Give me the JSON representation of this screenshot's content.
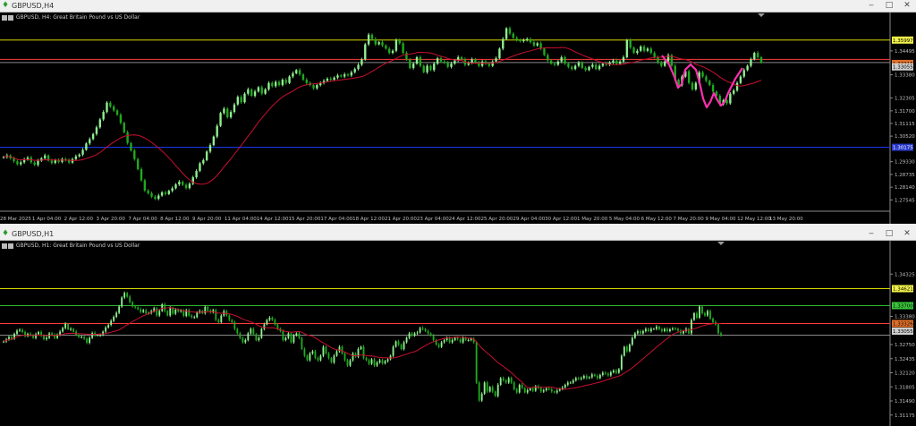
{
  "window_top": {
    "title": "GBPUSD,H4"
  },
  "window_bottom": {
    "title": "GBPUSD,H1"
  },
  "colors": {
    "bull": "#90ee90",
    "bear": "#1faa1f",
    "ma": "#c8102e",
    "yellow_line": "#d7d700",
    "red_line": "#ff3b3b",
    "blue_line": "#1e3cff",
    "green_line": "#2eb82e",
    "grey_line": "#888888",
    "pink_drawing": "#ff2fb0",
    "axis_text": "#bfbfbf",
    "label_yellow": "#f2f24a",
    "label_orange": "#e0702a",
    "label_green": "#3ac43a",
    "label_blue": "#2838c8",
    "label_grey": "#cfcfcf"
  },
  "chart_data": [
    {
      "type": "candlestick",
      "symbol": "GBPUSD",
      "timeframe": "H4",
      "title": "GBPUSD, H4: Great Britain Pound vs US Dollar",
      "ylim": [
        1.2702,
        1.357
      ],
      "yticks": [
        1.34495,
        1.3338,
        1.32305,
        1.317,
        1.31115,
        1.3052,
        1.2933,
        1.28735,
        1.2814,
        1.27545
      ],
      "xticks": [
        "28 Mar 2025",
        "1 Apr 04:00",
        "2 Apr 12:00",
        "3 Apr 20:00",
        "7 Apr 04:00",
        "8 Apr 12:00",
        "9 Apr 20:00",
        "11 Apr 04:00",
        "14 Apr 12:00",
        "15 Apr 20:00",
        "17 Apr 04:00",
        "18 Apr 12:00",
        "21 Apr 20:00",
        "23 Apr 04:00",
        "24 Apr 12:00",
        "25 Apr 20:00",
        "29 Apr 04:00",
        "30 Apr 12:00",
        "1 May 20:00",
        "5 May 04:00",
        "6 May 12:00",
        "7 May 20:00",
        "9 May 04:00",
        "12 May 12:00",
        "13 May 20:00"
      ],
      "price_labels": [
        {
          "value": "1.35997",
          "price": 1.35,
          "style": "yellow"
        },
        {
          "value": "1.33315",
          "price": 1.3391,
          "style": "orange"
        },
        {
          "value": "1.33055",
          "price": 1.3375,
          "style": "grey"
        },
        {
          "value": "1.30175",
          "price": 1.3,
          "style": "blue"
        }
      ],
      "hlines": [
        {
          "price": 1.35,
          "color": "yellow_line"
        },
        {
          "price": 1.341,
          "color": "red_line"
        },
        {
          "price": 1.3395,
          "color": "grey_line"
        },
        {
          "price": 1.3,
          "color": "blue_line"
        }
      ],
      "closes": [
        1.2955,
        1.2962,
        1.2948,
        1.2935,
        1.2921,
        1.293,
        1.2944,
        1.2952,
        1.293,
        1.2918,
        1.2937,
        1.2949,
        1.2962,
        1.2938,
        1.2927,
        1.294,
        1.2932,
        1.2945,
        1.294,
        1.2929,
        1.2945,
        1.2958,
        1.2966,
        1.2988,
        1.3018,
        1.3038,
        1.3062,
        1.3093,
        1.313,
        1.3165,
        1.3208,
        1.319,
        1.3172,
        1.3152,
        1.3114,
        1.307,
        1.302,
        1.2985,
        1.2945,
        1.2898,
        1.2846,
        1.2798,
        1.2786,
        1.277,
        1.276,
        1.2775,
        1.279,
        1.2782,
        1.2797,
        1.2809,
        1.2827,
        1.2839,
        1.2825,
        1.281,
        1.283,
        1.286,
        1.289,
        1.2925,
        1.294,
        1.298,
        1.301,
        1.305,
        1.31,
        1.316,
        1.318,
        1.314,
        1.3165,
        1.32,
        1.3235,
        1.321,
        1.325,
        1.327,
        1.324,
        1.326,
        1.328,
        1.325,
        1.327,
        1.33,
        1.3285,
        1.3305,
        1.329,
        1.3315,
        1.33,
        1.333,
        1.3345,
        1.336,
        1.334,
        1.3315,
        1.33,
        1.329,
        1.3275,
        1.329,
        1.33,
        1.331,
        1.332,
        1.3315,
        1.3325,
        1.3335,
        1.333,
        1.334,
        1.3335,
        1.335,
        1.3365,
        1.3385,
        1.341,
        1.348,
        1.3525,
        1.3505,
        1.348,
        1.349,
        1.3475,
        1.346,
        1.344,
        1.345,
        1.35,
        1.3485,
        1.344,
        1.341,
        1.337,
        1.339,
        1.342,
        1.338,
        1.335,
        1.338,
        1.336,
        1.339,
        1.3415,
        1.34,
        1.3395,
        1.3375,
        1.339,
        1.3405,
        1.342,
        1.341,
        1.3385,
        1.3395,
        1.341,
        1.3395,
        1.338,
        1.34,
        1.339,
        1.338,
        1.34,
        1.3415,
        1.346,
        1.3505,
        1.3555,
        1.353,
        1.351,
        1.35,
        1.3495,
        1.35,
        1.3505,
        1.349,
        1.3475,
        1.3485,
        1.346,
        1.343,
        1.3405,
        1.339,
        1.3385,
        1.34,
        1.342,
        1.339,
        1.3375,
        1.3365,
        1.338,
        1.3395,
        1.337,
        1.336,
        1.3375,
        1.3385,
        1.3365,
        1.338,
        1.339,
        1.3385,
        1.3395,
        1.3405,
        1.339,
        1.34,
        1.342,
        1.35,
        1.3465,
        1.344,
        1.345,
        1.347,
        1.345,
        1.346,
        1.344,
        1.342,
        1.3395,
        1.338,
        1.34,
        1.343,
        1.338,
        1.3315,
        1.329,
        1.333,
        1.3355,
        1.33,
        1.327,
        1.33,
        1.335,
        1.333,
        1.331,
        1.329,
        1.326,
        1.324,
        1.32,
        1.322,
        1.3205,
        1.325,
        1.3265,
        1.33,
        1.333,
        1.336,
        1.338,
        1.341,
        1.344,
        1.342,
        1.3395
      ]
    },
    {
      "type": "candlestick",
      "symbol": "GBPUSD",
      "timeframe": "H1",
      "title": "GBPUSD, H1: Great Britain Pound vs US Dollar",
      "ylim": [
        1.3097,
        1.3479
      ],
      "yticks": [
        1.34325,
        1.3338,
        1.3275,
        1.32435,
        1.3212,
        1.31805,
        1.3149,
        1.31175
      ],
      "price_labels": [
        {
          "value": "1.34621",
          "price": 1.34,
          "style": "yellow"
        },
        {
          "value": "1.33700",
          "price": 1.3362,
          "style": "green"
        },
        {
          "value": "1.33326",
          "price": 1.3322,
          "style": "orange"
        },
        {
          "value": "1.33055",
          "price": 1.3305,
          "style": "grey"
        }
      ],
      "hlines": [
        {
          "price": 1.34,
          "color": "yellow_line"
        },
        {
          "price": 1.3362,
          "color": "green_line"
        },
        {
          "price": 1.3322,
          "color": "red_line"
        },
        {
          "price": 1.3296,
          "color": "grey_line"
        }
      ],
      "closes": [
        1.3282,
        1.3286,
        1.3292,
        1.3288,
        1.3299,
        1.3306,
        1.3308,
        1.3303,
        1.3294,
        1.3299,
        1.3296,
        1.329,
        1.3298,
        1.3303,
        1.3295,
        1.3287,
        1.329,
        1.33,
        1.3297,
        1.329,
        1.3297,
        1.3304,
        1.3312,
        1.3321,
        1.3309,
        1.331,
        1.3304,
        1.3297,
        1.3292,
        1.3292,
        1.3288,
        1.3279,
        1.329,
        1.3301,
        1.3296,
        1.3296,
        1.3296,
        1.3304,
        1.3313,
        1.3319,
        1.3328,
        1.3337,
        1.3346,
        1.336,
        1.338,
        1.339,
        1.3382,
        1.337,
        1.336,
        1.3358,
        1.3354,
        1.3348,
        1.3352,
        1.3345,
        1.3345,
        1.335,
        1.3356,
        1.334,
        1.335,
        1.3365,
        1.335,
        1.334,
        1.3357,
        1.3344,
        1.3353,
        1.3349,
        1.3351,
        1.3339,
        1.3352,
        1.334,
        1.3336,
        1.3336,
        1.3347,
        1.335,
        1.3345,
        1.3359,
        1.3351,
        1.3347,
        1.3352,
        1.333,
        1.3325,
        1.334,
        1.335,
        1.334,
        1.333,
        1.3325,
        1.331,
        1.33,
        1.329,
        1.328,
        1.3285,
        1.33,
        1.331,
        1.3298,
        1.3285,
        1.329,
        1.331,
        1.332,
        1.333,
        1.3335,
        1.333,
        1.332,
        1.331,
        1.3305,
        1.3285,
        1.329,
        1.33,
        1.328,
        1.3295,
        1.33,
        1.329,
        1.3265,
        1.325,
        1.324,
        1.3255,
        1.326,
        1.3245,
        1.324,
        1.325,
        1.327,
        1.3255,
        1.3245,
        1.3235,
        1.325,
        1.326,
        1.327,
        1.3255,
        1.324,
        1.3228,
        1.324,
        1.3255,
        1.3248,
        1.3265,
        1.327,
        1.3245,
        1.324,
        1.3232,
        1.3242,
        1.3228,
        1.3235,
        1.324,
        1.3233,
        1.3238,
        1.3242,
        1.325,
        1.327,
        1.3282,
        1.3275,
        1.3265,
        1.328,
        1.329,
        1.33,
        1.3295,
        1.33,
        1.3302,
        1.3312,
        1.331,
        1.3305,
        1.33,
        1.3295,
        1.3285,
        1.3275,
        1.327,
        1.328,
        1.3285,
        1.329,
        1.328,
        1.3285,
        1.329,
        1.3287,
        1.328,
        1.329,
        1.3285,
        1.3285,
        1.3288,
        1.328,
        1.319,
        1.315,
        1.3165,
        1.319,
        1.317,
        1.318,
        1.317,
        1.316,
        1.3185,
        1.32,
        1.3195,
        1.319,
        1.32,
        1.319,
        1.3175,
        1.3168,
        1.3185,
        1.3178,
        1.3168,
        1.3173,
        1.3177,
        1.3172,
        1.3182,
        1.3178,
        1.317,
        1.3173,
        1.3177,
        1.3175,
        1.317,
        1.3168,
        1.3172,
        1.3176,
        1.3179,
        1.3185,
        1.319,
        1.319,
        1.3195,
        1.32,
        1.3198,
        1.32,
        1.3205,
        1.32,
        1.3202,
        1.3208,
        1.3205,
        1.32,
        1.3207,
        1.3212,
        1.321,
        1.3206,
        1.3213,
        1.3217,
        1.3212,
        1.322,
        1.325,
        1.327,
        1.326,
        1.3275,
        1.329,
        1.33,
        1.3305,
        1.33,
        1.3305,
        1.331,
        1.3305,
        1.331,
        1.331,
        1.3315,
        1.3309,
        1.3305,
        1.331,
        1.3305,
        1.3309,
        1.3311,
        1.331,
        1.3306,
        1.33,
        1.3305,
        1.331,
        1.33,
        1.333,
        1.3345,
        1.3335,
        1.336,
        1.3345,
        1.334,
        1.335,
        1.3333,
        1.3325,
        1.332,
        1.33,
        1.3296
      ]
    }
  ],
  "drawing_path_h4": [
    [
      740,
      48
    ],
    [
      748,
      58
    ],
    [
      754,
      72
    ],
    [
      758,
      84
    ],
    [
      762,
      80
    ],
    [
      766,
      64
    ],
    [
      772,
      58
    ],
    [
      778,
      64
    ],
    [
      782,
      78
    ],
    [
      786,
      96
    ],
    [
      790,
      106
    ],
    [
      794,
      100
    ],
    [
      798,
      90
    ],
    [
      802,
      98
    ],
    [
      806,
      104
    ],
    [
      810,
      100
    ],
    [
      814,
      90
    ],
    [
      818,
      82
    ],
    [
      822,
      74
    ],
    [
      826,
      68
    ],
    [
      830,
      62
    ]
  ]
}
